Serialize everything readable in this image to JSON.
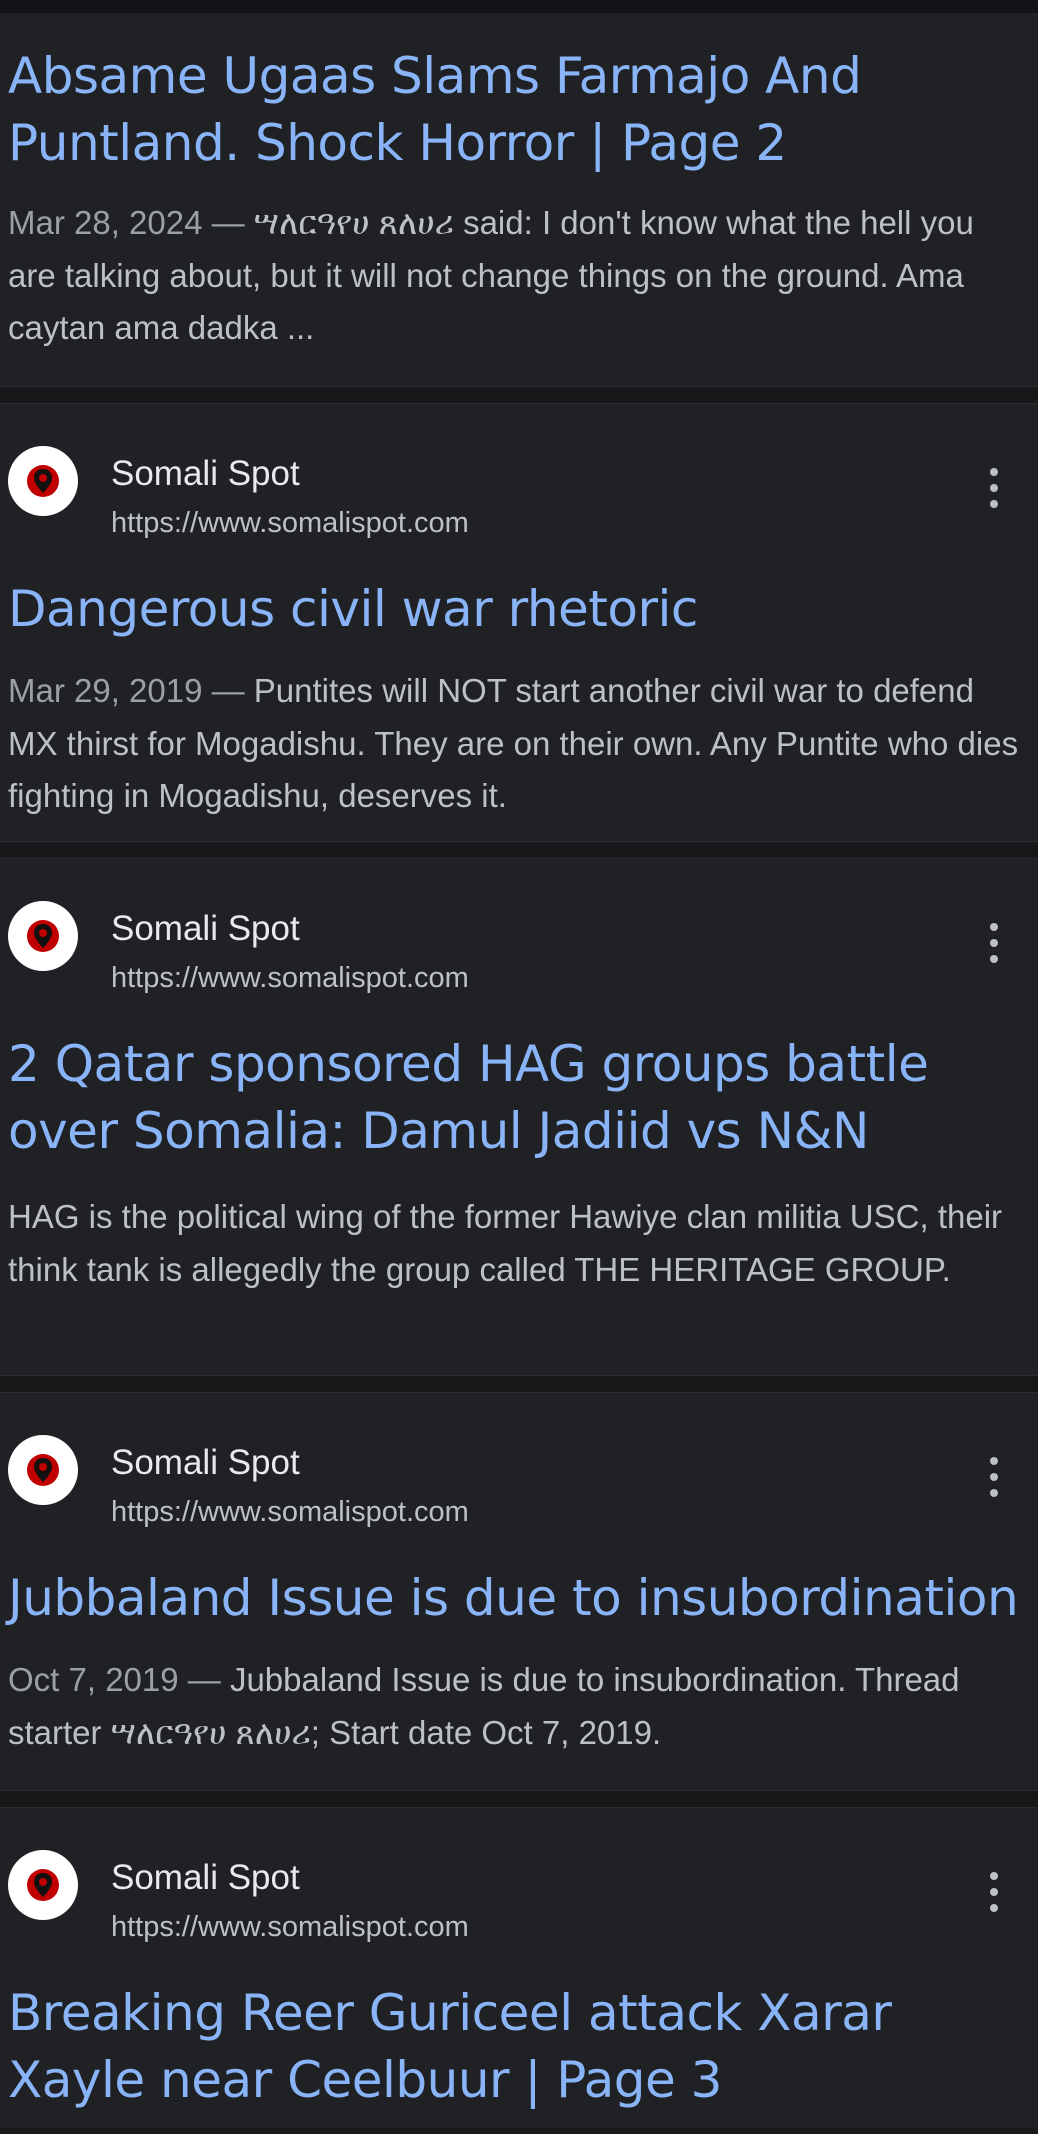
{
  "results": [
    {
      "title": "Absame Ugaas Slams Farmajo And Puntland. Shock Horror | Page 2",
      "date": "Mar 28, 2024 — ",
      "snippet": "ሣለርዓየሀ ጸለሀሪ said: I don't know what the hell you are talking about, but it will not change things on the ground. Ama caytan ama dadka ..."
    },
    {
      "site": "Somali Spot",
      "url": "https://www.somalispot.com",
      "icon": "more-vert-icon",
      "title": "Dangerous civil war rhetoric",
      "date": "Mar 29, 2019 — ",
      "snippet": "Puntites will NOT start another civil war to defend MX thirst for Mogadishu. They are on their own. Any Puntite who dies fighting in Mogadishu, deserves it."
    },
    {
      "site": "Somali Spot",
      "url": "https://www.somalispot.com",
      "icon": "more-vert-icon",
      "title": "2 Qatar sponsored HAG groups battle over Somalia: Damul Jadiid vs N&N",
      "date": "",
      "snippet": "HAG is the political wing of the former Hawiye clan militia USC, their think tank is allegedly the group called THE HERITAGE GROUP."
    },
    {
      "site": "Somali Spot",
      "url": "https://www.somalispot.com",
      "icon": "more-vert-icon",
      "title": "Jubbaland Issue is due to insubordination",
      "date": "Oct 7, 2019 — ",
      "snippet": "Jubbaland Issue is due to insubordination. Thread starter ሣለርዓየሀ ጸለሀሪ; Start date Oct 7, 2019."
    },
    {
      "site": "Somali Spot",
      "url": "https://www.somalispot.com",
      "icon": "more-vert-icon",
      "title": "Breaking Reer Guriceel attack Xarar Xayle near Ceelbuur | Page 3"
    }
  ],
  "colors": {
    "background": "#202124",
    "title": "#8ab4f8",
    "text": "#bdc1c6",
    "separator": "#17181a",
    "favicon_pin": "#c00000"
  }
}
